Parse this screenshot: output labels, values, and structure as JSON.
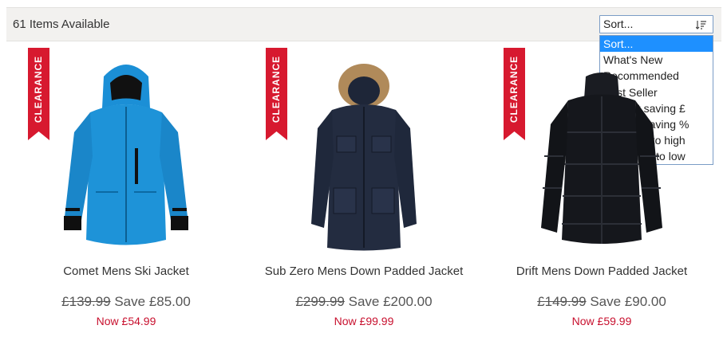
{
  "listing": {
    "items_available": "61 Items Available"
  },
  "sort": {
    "selected": "Sort...",
    "icon": "sort-icon",
    "options": [
      "Sort...",
      "What's New",
      "Recommended",
      "Best Seller",
      "Biggest saving £",
      "Biggest saving %",
      "Price low to high",
      "Price high to low"
    ]
  },
  "products": [
    {
      "badge": "CLEARANCE",
      "name": "Comet Mens Ski Jacket",
      "was_price": "£139.99",
      "save": " Save £85.00",
      "now_price": "Now £54.99",
      "image": "blue-ski-jacket"
    },
    {
      "badge": "CLEARANCE",
      "name": "Sub Zero Mens Down Padded Jacket",
      "was_price": "£299.99",
      "save": " Save £200.00",
      "now_price": "Now £99.99",
      "image": "navy-parka-fur-hood"
    },
    {
      "badge": "CLEARANCE",
      "name": "Drift Mens Down Padded Jacket",
      "was_price": "£149.99",
      "save": " Save £90.00",
      "now_price": "Now £59.99",
      "image": "black-puffer-jacket"
    }
  ],
  "colors": {
    "ribbon": "#d7192f",
    "now_price": "#c8102e",
    "selected_option": "#1e90ff"
  }
}
